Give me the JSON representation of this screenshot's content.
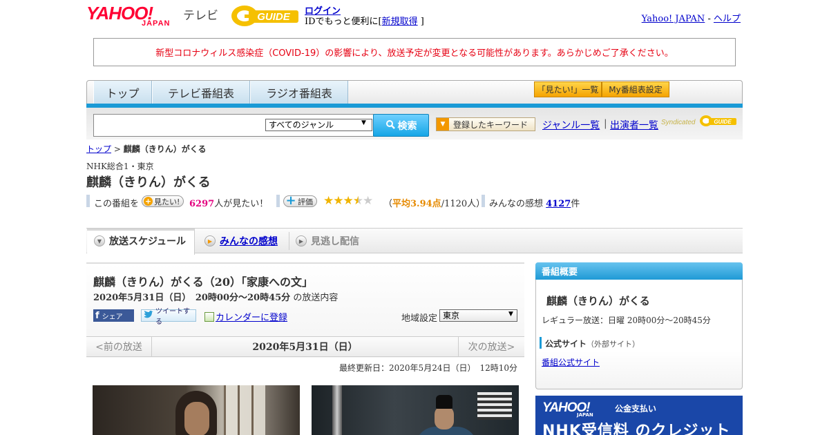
{
  "header": {
    "logo_yahoo": "YAHOO!",
    "logo_japan": "JAPAN",
    "logo_tv": "テレビ",
    "gguide_text": "GUIDE",
    "login_label": "ログイン",
    "id_prefix": "IDでもっと便利に[",
    "signup_label": "新規取得",
    "id_suffix": "]",
    "yahoo_japan_link": "Yahoo! JAPAN",
    "link_separator": "-",
    "help_link": "ヘルプ"
  },
  "notice": "新型コロナウィルス感染症（COVID-19）の影響により、放送予定が変更となる可能性があります。あらかじめご了承ください。",
  "nav": {
    "tabs": [
      "トップ",
      "テレビ番組表",
      "ラジオ番組表"
    ],
    "mitai_list_label": "「見たい!」一覧",
    "my_schedule_label": "My番組表設定"
  },
  "search": {
    "query": "",
    "genre_selected": "すべてのジャンル",
    "button_label": "検索",
    "keyword_button": "登録したキーワード",
    "genre_list_link": "ジャンル一覧",
    "separator": "|",
    "performer_list_link": "出演者一覧",
    "syndicated_label": "Syndicated"
  },
  "breadcrumb": {
    "top_link": "トップ",
    "separator": ">",
    "current": "麒麟（きりん）がくる"
  },
  "program": {
    "channel": "NHK総合1・東京",
    "title": "麒麟（きりん）がくる",
    "stats": {
      "prefix": "この番組を",
      "mitai_pill": "見たい!",
      "mitai_count": "6297",
      "mitai_suffix": "人が見たい！",
      "rate_pill": "評価",
      "rating": 3.94,
      "avg_open": "（",
      "avg_label": "平均3.94点",
      "avg_count": "/1120人）",
      "review_prefix": "みんなの感想",
      "review_count": "4127",
      "review_suffix": "件"
    }
  },
  "tabs": {
    "schedule": "放送スケジュール",
    "reviews": "みんなの感想",
    "vod": "見逃し配信"
  },
  "episode": {
    "title": "麒麟（きりん）がくる（20）「家康への文」",
    "date_time": "2020年5月31日（日）　20時00分～20時45分",
    "date_suffix": "の放送内容",
    "share_label": "シェア",
    "tweet_label": "ツイートする",
    "calendar_label": "カレンダーに登録",
    "region_label": "地域設定",
    "region_selected": "東京",
    "prev_label": "<前の放送",
    "current_day": "2020年5月31日（日）",
    "next_label": "次の放送>",
    "last_updated": "最終更新日：2020年5月24日（日）　12時10分"
  },
  "side": {
    "header": "番組概要",
    "title": "麒麟（きりん）がくる",
    "regular": "レギュラー放送：日曜 20時00分～20時45分",
    "official_label": "公式サイト",
    "official_note": "（外部サイト）",
    "official_link": "番組公式サイト"
  },
  "ad": {
    "yahoo": "YAHOO!",
    "japan": "JAPAN",
    "sub": "公金支払い",
    "main": "NHK受信料 のクレジット"
  },
  "colors": {
    "accent_blue": "#1a9ad6",
    "notice_red": "#e60012",
    "star_gold": "#f0b400",
    "mitai_pink": "#e4007f"
  }
}
